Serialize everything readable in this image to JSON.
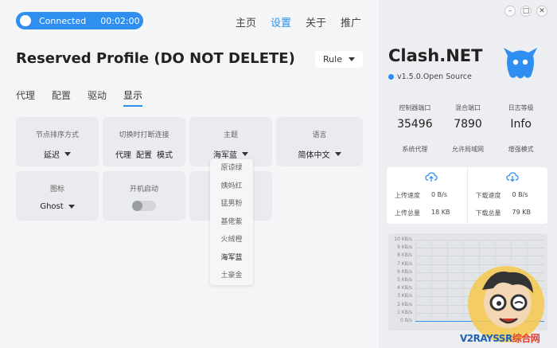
{
  "status": {
    "label": "Connected",
    "timer": "00:02:00"
  },
  "topnav": [
    {
      "label": "主页",
      "active": false
    },
    {
      "label": "设置",
      "active": true
    },
    {
      "label": "关于",
      "active": false
    },
    {
      "label": "推广",
      "active": false
    }
  ],
  "profile_title": "Reserved Profile (DO NOT DELETE)",
  "mode_select": {
    "value": "Rule"
  },
  "subtabs": [
    {
      "label": "代理"
    },
    {
      "label": "配置"
    },
    {
      "label": "驱动"
    },
    {
      "label": "显示"
    }
  ],
  "cards": {
    "sort": {
      "title": "节点排序方式",
      "value": "延迟"
    },
    "disconnect": {
      "title": "切换时打断连接",
      "opt1": "代理",
      "opt2": "配置",
      "opt3": "模式"
    },
    "theme": {
      "title": "主题",
      "value": "海军蓝"
    },
    "language": {
      "title": "语言",
      "value": "简体中文"
    },
    "icon": {
      "title": "图标",
      "value": "Ghost"
    },
    "autostart": {
      "title": "开机启动"
    }
  },
  "theme_options": [
    "原谅绿",
    "姨妈红",
    "猛男粉",
    "基佬紫",
    "火绒橙",
    "海军蓝",
    "土豪金"
  ],
  "theme_selected": "海军蓝",
  "window_buttons": {
    "minimize": "–",
    "maximize": "□",
    "close": "✕"
  },
  "brand": {
    "name": "Clash.NET",
    "version": "v1.5.0.Open Source"
  },
  "ports": {
    "controller": {
      "label": "控制器端口",
      "value": "35496"
    },
    "mixed": {
      "label": "混合端口",
      "value": "7890"
    },
    "loglevel": {
      "label": "日志等级",
      "value": "Info"
    }
  },
  "features": [
    "系统代理",
    "允许局域网",
    "增强模式"
  ],
  "traffic": {
    "upload_speed_label": "上传速度",
    "upload_speed": "0 B/s",
    "upload_total_label": "上传总量",
    "upload_total": "18 KB",
    "download_speed_label": "下载速度",
    "download_speed": "0 B/s",
    "download_total_label": "下载总量",
    "download_total": "79 KB"
  },
  "graph_ticks": [
    "10 KB/s",
    "9 KB/s",
    "8 KB/s",
    "7 KB/s",
    "6 KB/s",
    "5 KB/s",
    "4 KB/s",
    "3 KB/s",
    "2 KB/s",
    "1 KB/s",
    "0 B/s"
  ],
  "watermark": {
    "part1": "V2RAYSSR",
    "part2": "综合网"
  },
  "colors": {
    "accent": "#2f8ff0",
    "ghost": "#2f8ff0"
  }
}
